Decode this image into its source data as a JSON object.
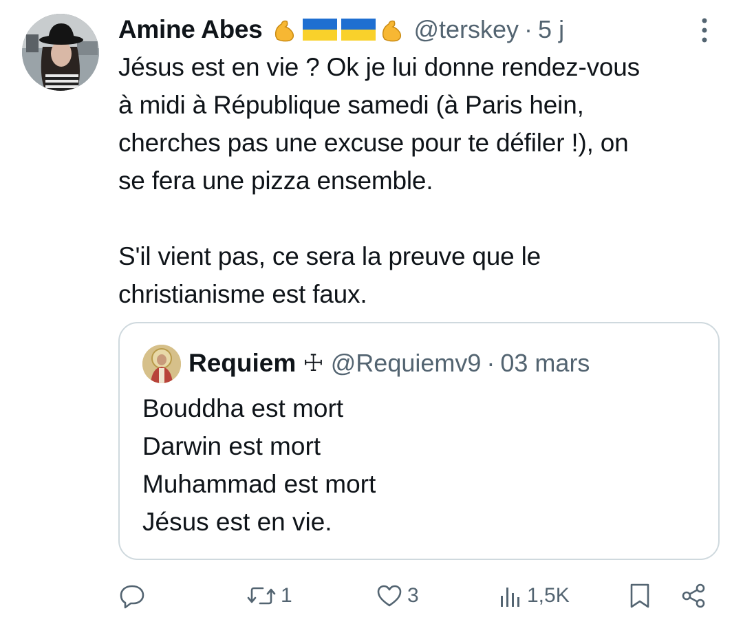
{
  "tweet": {
    "author_name": "Amine Abes",
    "emojis": [
      "flexed-biceps",
      "flag-ukraine",
      "flag-ukraine",
      "flexed-biceps"
    ],
    "handle": "@terskey",
    "separator": "·",
    "time": "5 j",
    "text": "Jésus est en vie ? Ok je lui donne rendez-vous\nà midi à République samedi (à Paris hein,\ncherches pas une excuse pour te défiler !), on\nse fera une pizza ensemble.\n\nS'il vient pas, ce sera la preuve que le\nchristianisme est faux."
  },
  "quote": {
    "author_name": "Requiem",
    "cross": "☩",
    "handle": "@Requiemv9",
    "separator": "·",
    "time": "03 mars",
    "text": "Bouddha est mort\nDarwin est mort\nMuhammad est mort\nJésus est en vie."
  },
  "actions": {
    "reply_count": "",
    "retweet_count": "1",
    "like_count": "3",
    "views_count": "1,5K"
  },
  "icons": {
    "more": "more-vertical-icon",
    "reply": "reply-icon",
    "retweet": "retweet-icon",
    "like": "heart-icon",
    "views": "views-icon",
    "bookmark": "bookmark-icon",
    "share": "share-icon"
  },
  "colors": {
    "text": "#0f1419",
    "secondary": "#536471",
    "border": "#cfd9de",
    "background": "#ffffff"
  }
}
